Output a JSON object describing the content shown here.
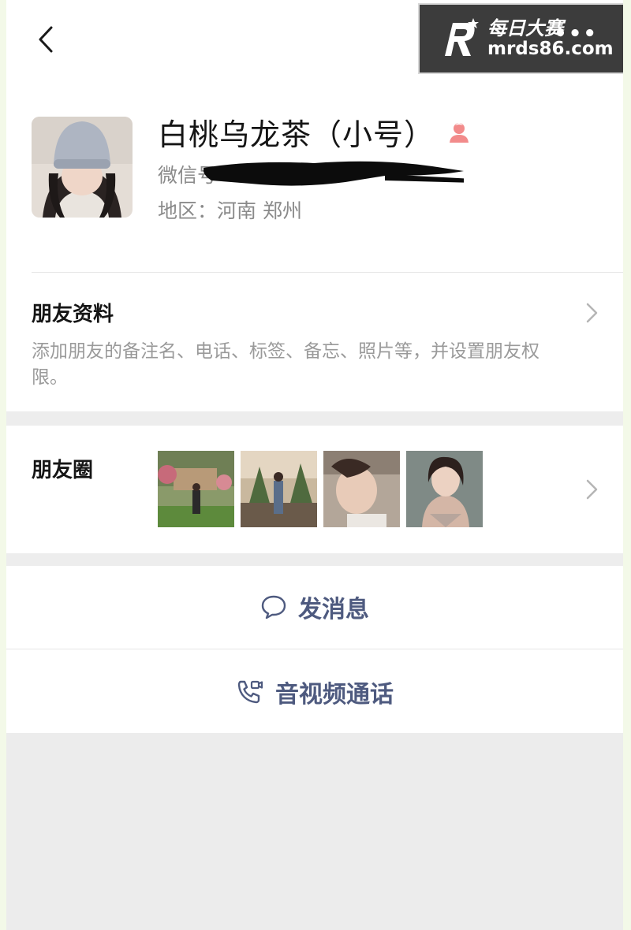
{
  "header": {
    "back_icon": "chevron-left-icon",
    "more_icon": "more-dots-icon",
    "more_label": "•••"
  },
  "watermark": {
    "brand_cn": "每日大赛",
    "brand_en": "mrds86.com"
  },
  "profile": {
    "name": "白桃乌龙茶（小号）",
    "gender_icon": "female-icon",
    "wechat_id_label": "微信号",
    "region_label": "地区：河南 郑州"
  },
  "friend_info": {
    "title": "朋友资料",
    "description": "添加朋友的备注名、电话、标签、备忘、照片等，并设置朋友权限。"
  },
  "moments": {
    "title": "朋友圈",
    "thumbnail_count": 4
  },
  "actions": {
    "message_label": "发消息",
    "message_icon": "chat-bubble-icon",
    "call_label": "音视频通话",
    "call_icon": "phone-video-icon"
  },
  "colors": {
    "action_text": "#4e5a7f",
    "female_icon": "#f28b8b",
    "watermark_bg": "#3c3c3c"
  }
}
